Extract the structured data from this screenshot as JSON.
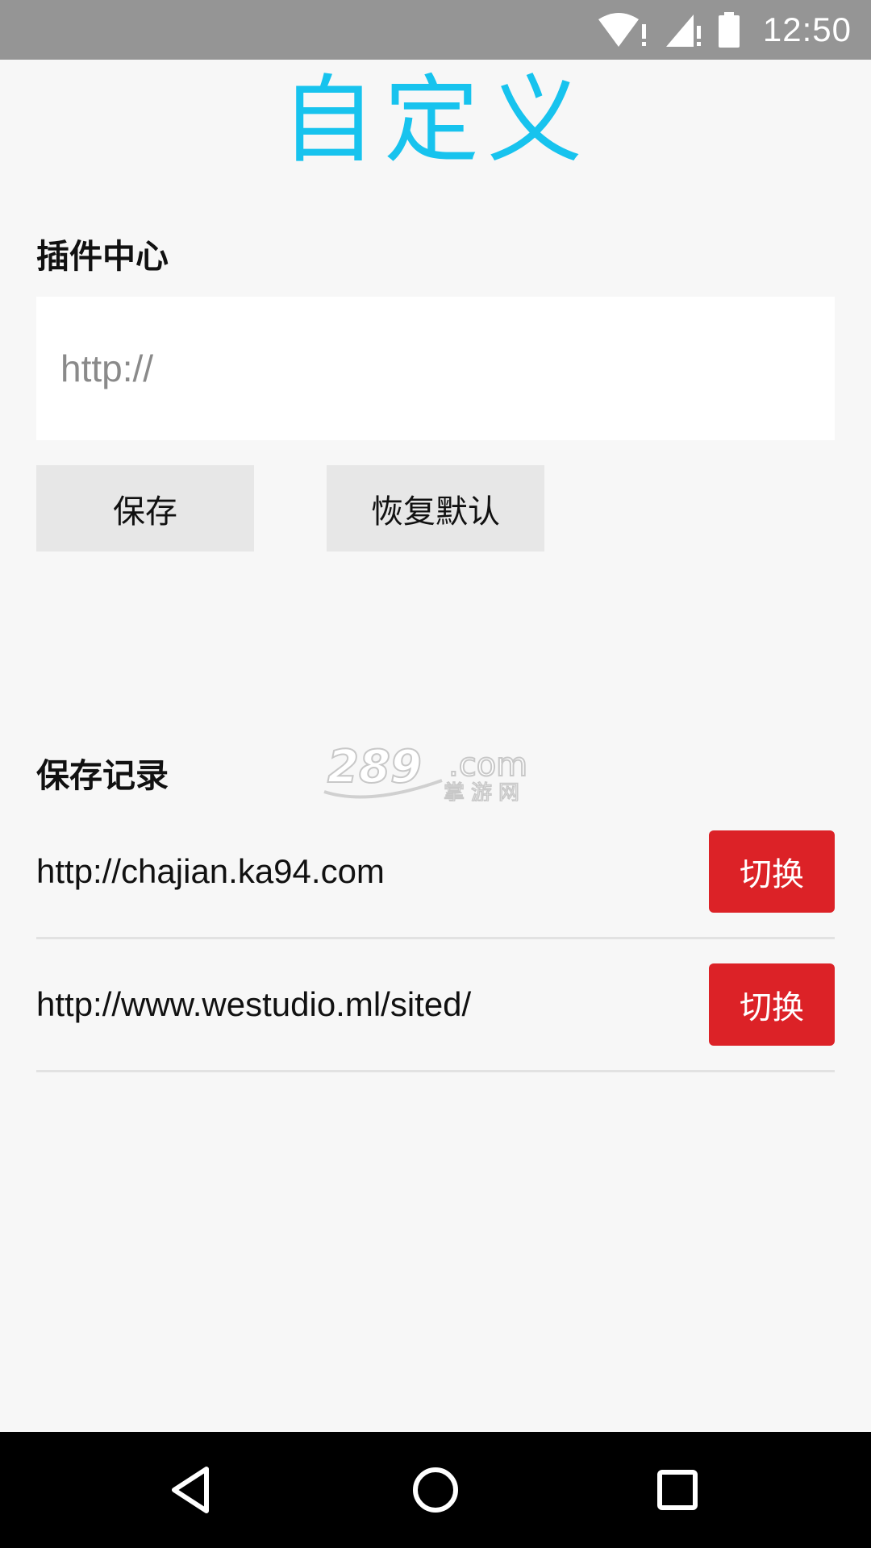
{
  "status_bar": {
    "time": "12:50",
    "icons": [
      "wifi-alert-icon",
      "cell-signal-alert-icon",
      "battery-icon"
    ]
  },
  "page": {
    "title": "自定义"
  },
  "plugin_center": {
    "label": "插件中心",
    "input_placeholder": "http://",
    "input_value": "",
    "save_label": "保存",
    "reset_label": "恢复默认"
  },
  "history": {
    "label": "保存记录",
    "items": [
      {
        "url": "http://chajian.ka94.com",
        "button": "切换"
      },
      {
        "url": "http://www.westudio.ml/sited/",
        "button": "切换"
      }
    ]
  },
  "watermark": {
    "text": "289.com",
    "subtext": "掌游网"
  },
  "nav_bar": {
    "icons": [
      "back-icon",
      "home-icon",
      "recent-apps-icon"
    ]
  },
  "colors": {
    "title": "#17c3ee",
    "switch_button": "#dc2227",
    "status_bar": "#959595",
    "background": "#f7f7f7"
  }
}
